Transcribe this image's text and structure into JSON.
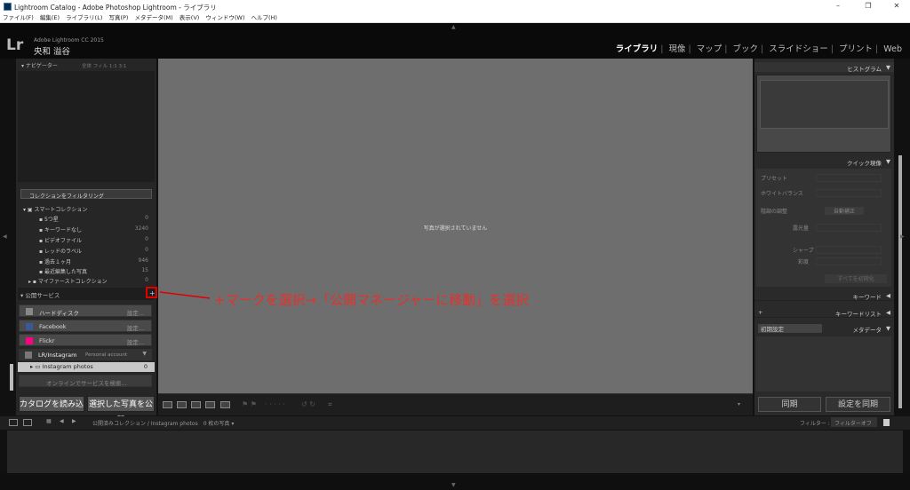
{
  "window": {
    "title": "Lightroom Catalog - Adobe Photoshop Lightroom - ライブラリ",
    "controls": [
      "–",
      "❐",
      "✕"
    ]
  },
  "menu": [
    "ファイル(F)",
    "編集(E)",
    "ライブラリ(L)",
    "写真(P)",
    "メタデータ(M)",
    "表示(V)",
    "ウィンドウ(W)",
    "ヘルプ(H)"
  ],
  "identity": {
    "logo": "Lr",
    "version": "Adobe Lightroom CC 2015",
    "user": "央和 溢谷"
  },
  "modules": [
    "ライブラリ",
    "現像",
    "マップ",
    "ブック",
    "スライドショー",
    "プリント",
    "Web"
  ],
  "left": {
    "navigator": "ナビゲーター",
    "zoom": "全体 フィル 1:1 3:1",
    "filter": "コレクションをフィルタリング",
    "smart_collections": "スマートコレクション",
    "collections": [
      {
        "name": "5つ星",
        "count": "0"
      },
      {
        "name": "キーワードなし",
        "count": "3240"
      },
      {
        "name": "ビデオファイル",
        "count": "0"
      },
      {
        "name": "レッドのラベル",
        "count": "0"
      },
      {
        "name": "過去１ヶ月",
        "count": "946"
      },
      {
        "name": "最近編集した写真",
        "count": "15"
      }
    ],
    "first_collection": "マイファーストコレクション",
    "first_count": "0",
    "publish_header": "公開サービス",
    "services": [
      {
        "name": "ハードディスク",
        "cfg": "設定..."
      },
      {
        "name": "Facebook",
        "cfg": "設定..."
      },
      {
        "name": "Flickr",
        "cfg": "設定..."
      }
    ],
    "instagram": "LR/Instagram",
    "instagram_sub": "Personal account",
    "instagram_photos": "Instagram photos",
    "instagram_count": "0",
    "find_online": "オンラインでサービスを検索...",
    "import_btn": "カタログを読み込み",
    "publish_btn": "選択した写真を公開"
  },
  "center": {
    "empty_message": "写真が選択されていません"
  },
  "annotation": "+マークを選択→「公開マネージャーに移動」を選択",
  "right": {
    "histogram": "ヒストグラム",
    "quick_develop": "クイック現像",
    "preset": "プリセット",
    "white_balance": "ホワイトバランス",
    "tone": "階調の調整",
    "tone_btn": "自動補正",
    "exposure": "露光量",
    "sharpen": "シャープ",
    "vibrance": "彩度",
    "reset": "すべてを初期化",
    "keyword": "キーワード",
    "keyword_list": "キーワードリスト",
    "metadata": "メタデータ",
    "default": "初期設定",
    "sync": "同期",
    "sync_settings": "設定を同期"
  },
  "filmstrip": {
    "path": "公開済みコレクション / Instagram photos　0 枚の写真 ▾",
    "filter_label": "フィルター :",
    "filter_value": "フィルターオフ"
  }
}
